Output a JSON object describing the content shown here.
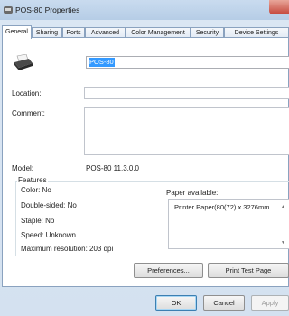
{
  "window": {
    "title": "POS-80 Properties"
  },
  "tabs": [
    {
      "label": "General",
      "active": true
    },
    {
      "label": "Sharing"
    },
    {
      "label": "Ports"
    },
    {
      "label": "Advanced"
    },
    {
      "label": "Color Management"
    },
    {
      "label": "Security"
    },
    {
      "label": "Device Settings"
    }
  ],
  "general": {
    "printer_name": "POS-80",
    "location_label": "Location:",
    "location_value": "",
    "comment_label": "Comment:",
    "comment_value": "",
    "model_label": "Model:",
    "model_value": "POS-80 11.3.0.0",
    "features": {
      "title": "Features",
      "color": "Color: No",
      "double_sided": "Double-sided: No",
      "staple": "Staple: No",
      "speed": "Speed: Unknown",
      "max_resolution": "Maximum resolution: 203 dpi",
      "paper_available_label": "Paper available:",
      "paper_items": [
        "Printer Paper(80(72) x 3276mm"
      ]
    },
    "preferences_label": "Preferences...",
    "print_test_label": "Print Test Page"
  },
  "footer": {
    "ok_label": "OK",
    "cancel_label": "Cancel",
    "apply_label": "Apply"
  },
  "icons": {
    "title": "printer-icon",
    "printer": "printer-icon",
    "close": "close-icon"
  }
}
